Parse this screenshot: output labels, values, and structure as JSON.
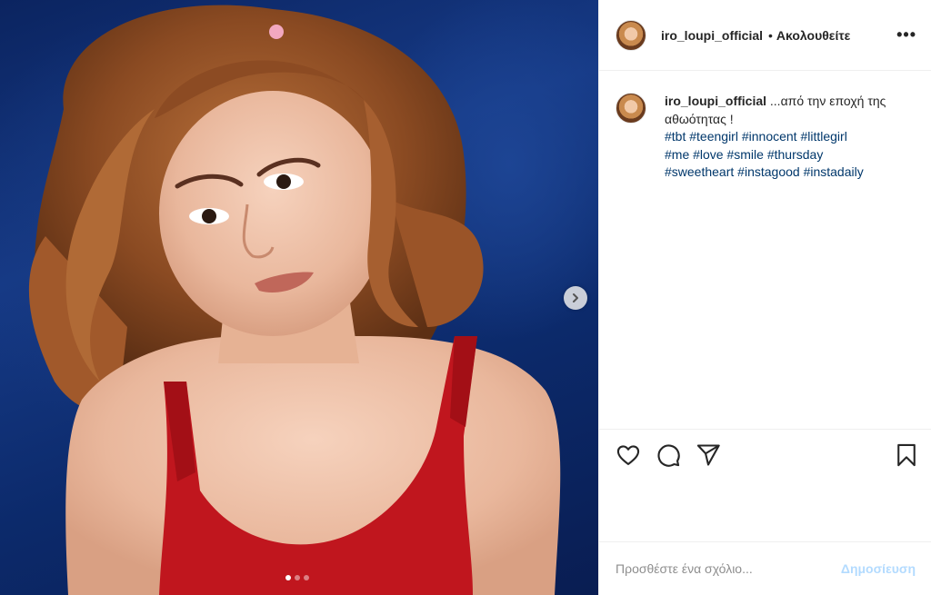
{
  "post": {
    "username": "iro_loupi_official",
    "follow_separator": "•",
    "follow_label": "Ακολουθείτε",
    "more_label": "•••",
    "carousel": {
      "slide_count": 3,
      "active_slide": 1
    }
  },
  "caption": {
    "username": "iro_loupi_official",
    "text": "...από την εποχή της αθωότητας !",
    "hashtags": [
      "#tbt",
      "#teengirl",
      "#innocent",
      "#littlegirl",
      "#me",
      "#love",
      "#smile",
      "#thursday",
      "#sweetheart",
      "#instagood",
      "#instadaily"
    ]
  },
  "actions": {
    "icons": [
      "heart-icon",
      "comment-icon",
      "share-icon",
      "bookmark-icon"
    ]
  },
  "comment": {
    "placeholder": "Προσθέστε ένα σχόλιο...",
    "post_label": "Δημοσίευση"
  },
  "colors": {
    "text": "#262626",
    "hashtag": "#00376b",
    "post_button_disabled": "#b3dbff",
    "border": "#efefef"
  }
}
